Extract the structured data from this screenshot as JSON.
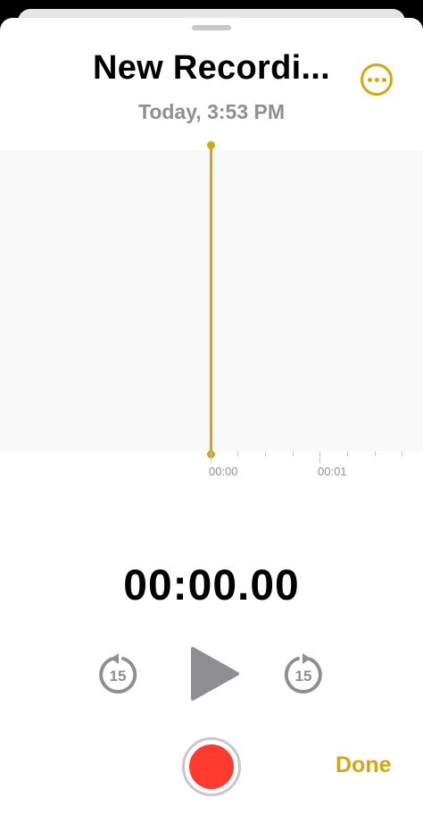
{
  "recording": {
    "title": "New Recordi...",
    "date": "Today, 3:53 PM"
  },
  "timeline": {
    "labels": [
      "00:00",
      "00:01"
    ]
  },
  "playback": {
    "elapsed": "00:00.00",
    "skip_back_seconds": "15",
    "skip_forward_seconds": "15"
  },
  "actions": {
    "done_label": "Done"
  },
  "colors": {
    "accent": "#d4a60f",
    "record": "#ff3b30",
    "control_gray": "#8e8e93",
    "background": "#ffffff"
  },
  "icons": {
    "more": "ellipsis-circle-icon",
    "skip_back": "gobackward-15-icon",
    "play": "play-icon",
    "skip_forward": "goforward-15-icon",
    "record": "record-icon"
  }
}
